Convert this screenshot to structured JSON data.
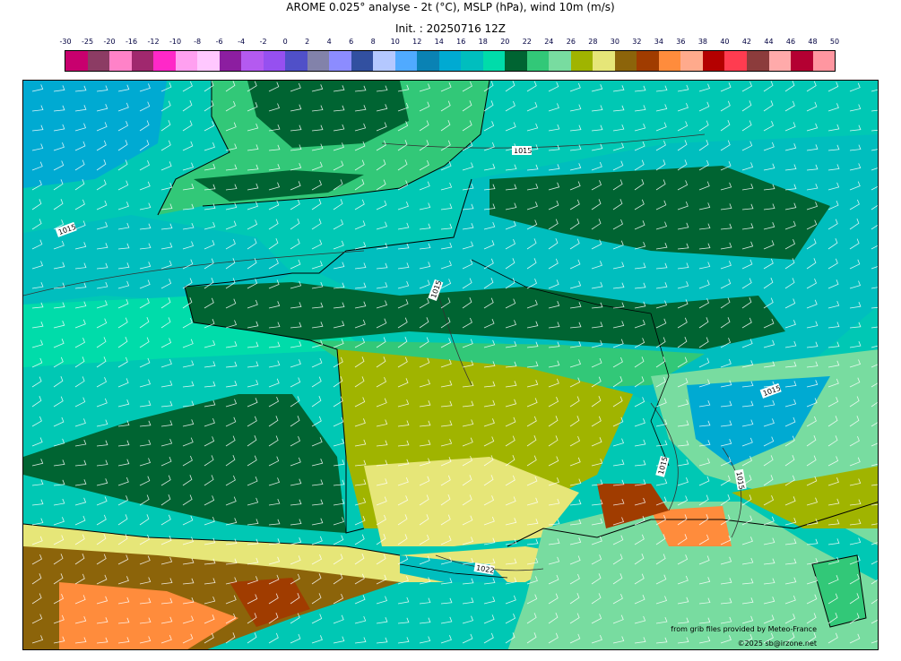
{
  "header": {
    "title": "AROME 0.025° analyse - 2t (°C), MSLP (hPa), wind 10m (m/s)",
    "init": "Init. : 20250716 12Z"
  },
  "colorbar": {
    "ticks": [
      "-30",
      "-25",
      "-20",
      "-16",
      "-12",
      "-10",
      "-8",
      "-6",
      "-4",
      "-2",
      "0",
      "2",
      "4",
      "6",
      "8",
      "10",
      "12",
      "14",
      "16",
      "18",
      "20",
      "22",
      "24",
      "26",
      "28",
      "30",
      "32",
      "34",
      "36",
      "38",
      "40",
      "42",
      "44",
      "46",
      "48",
      "50"
    ],
    "colors": [
      "#c8006e",
      "#8c3c64",
      "#ff82c8",
      "#a0286e",
      "#ff28c8",
      "#ffa0f0",
      "#ffc8ff",
      "#8c1ea0",
      "#b45af0",
      "#9650f0",
      "#5050c8",
      "#8282aa",
      "#8c8cff",
      "#3250a0",
      "#b4c8ff",
      "#50aaff",
      "#0a82b4",
      "#00aad2",
      "#00bebe",
      "#00dcaa",
      "#006432",
      "#32c878",
      "#78dca0",
      "#a0b400",
      "#e6e678",
      "#8c640a",
      "#a03c00",
      "#ff8c3c",
      "#ffaa8c",
      "#b40000",
      "#ff3c50",
      "#8c3c3c",
      "#ffaaaa",
      "#b40032",
      "#ff96a0"
    ]
  },
  "map": {
    "isobar_labels": [
      "1015",
      "1015",
      "1015",
      "1015",
      "1015",
      "1015",
      "1022"
    ],
    "credit_source": "from grib files provided by Meteo-France",
    "credit_copyright": "©2025 sb@irzone.net"
  }
}
